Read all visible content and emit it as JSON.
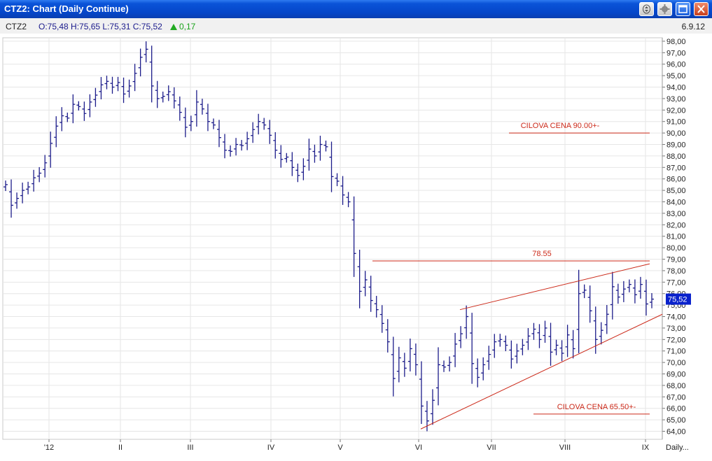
{
  "window": {
    "title": "CTZ2: Chart (Daily Continue)",
    "buttons": [
      {
        "name": "scroll-button",
        "icon": "scroll-icon"
      },
      {
        "name": "settings-button",
        "icon": "gear-icon"
      },
      {
        "name": "maximize-button",
        "icon": "maximize-icon"
      },
      {
        "name": "close-button",
        "icon": "close-icon"
      }
    ]
  },
  "infobar": {
    "symbol": "CTZ2",
    "values": "O:75,48 H:75,65 L:75,31 C:75,52",
    "change": "0,17",
    "change_icon": "up-triangle-icon",
    "change_color": "#22aa22",
    "date": "6.9.12"
  },
  "chart_data": {
    "type": "ohlc",
    "period_label": "Daily...",
    "x_tick_labels": [
      "'12",
      "II",
      "III",
      "IV",
      "V",
      "VI",
      "VII",
      "VIII",
      "IX"
    ],
    "ylim": [
      63.3,
      98.3
    ],
    "y_ticks": [
      64,
      65,
      66,
      67,
      68,
      69,
      70,
      71,
      72,
      73,
      74,
      75,
      76,
      77,
      78,
      79,
      80,
      81,
      82,
      83,
      84,
      85,
      86,
      87,
      88,
      89,
      90,
      91,
      92,
      93,
      94,
      95,
      96,
      97,
      98
    ],
    "decimal_separator": ",",
    "last_price": 75.52,
    "last_price_label": "75,52",
    "bar_color": "#1c1c8a",
    "last_price_bg": "#0a22cc",
    "annotation_color": "#cc2a1a",
    "grid": true,
    "closes": [
      85.5,
      83.7,
      84.3,
      85.0,
      85.3,
      86.1,
      86.5,
      87.4,
      89.1,
      90.6,
      91.5,
      91.3,
      92.5,
      92.3,
      91.7,
      92.7,
      93.3,
      94.2,
      94.5,
      94.0,
      94.4,
      93.4,
      94.1,
      95.2,
      96.6,
      97.3,
      94.1,
      93.0,
      93.2,
      93.6,
      92.8,
      91.8,
      90.5,
      91.0,
      92.7,
      92.1,
      91.0,
      90.7,
      89.6,
      88.5,
      88.4,
      89.0,
      88.9,
      89.5,
      90.3,
      91.0,
      90.7,
      89.8,
      88.5,
      87.7,
      87.9,
      87.0,
      86.3,
      87.1,
      88.6,
      88.0,
      89.0,
      88.8,
      86.2,
      85.8,
      84.6,
      84.0,
      79.5,
      76.2,
      77.2,
      75.4,
      74.6,
      73.4,
      71.8,
      68.6,
      70.4,
      69.5,
      71.2,
      69.8,
      66.2,
      64.9,
      66.7,
      69.8,
      69.6,
      70.0,
      71.6,
      72.5,
      74.0,
      69.9,
      68.7,
      69.8,
      70.7,
      71.8,
      72.0,
      71.5,
      70.3,
      71.0,
      71.5,
      72.3,
      72.9,
      72.0,
      73.0,
      70.9,
      71.5,
      70.8,
      72.4,
      71.2,
      76.0,
      76.3,
      74.5,
      72.0,
      72.8,
      74.2,
      76.6,
      75.7,
      76.4,
      76.8,
      75.9,
      76.8,
      75.1,
      75.52
    ],
    "annotations": [
      {
        "type": "hline",
        "y": 90.0,
        "x_span": [
          "VIII (start)",
          "IX (end)"
        ],
        "label": "CILOVA CENA 90.00+-"
      },
      {
        "type": "hline",
        "y": 78.85,
        "x_span": [
          "V (mid)",
          "IX (end)"
        ],
        "label": "78.55"
      },
      {
        "type": "hline",
        "y": 65.5,
        "x_span": [
          "VIII (mid)",
          "IX (end)"
        ],
        "label": "CILOVA CENA 65.50+-"
      },
      {
        "type": "trendline",
        "from": {
          "x": "VI",
          "y": 64.2
        },
        "to": {
          "x": "IX (end)",
          "y": 74.2
        },
        "label": ""
      },
      {
        "type": "trendline",
        "from": {
          "x": "VI (mid)",
          "y": 74.6
        },
        "to": {
          "x": "IX (end)",
          "y": 78.6
        },
        "label": ""
      }
    ]
  }
}
